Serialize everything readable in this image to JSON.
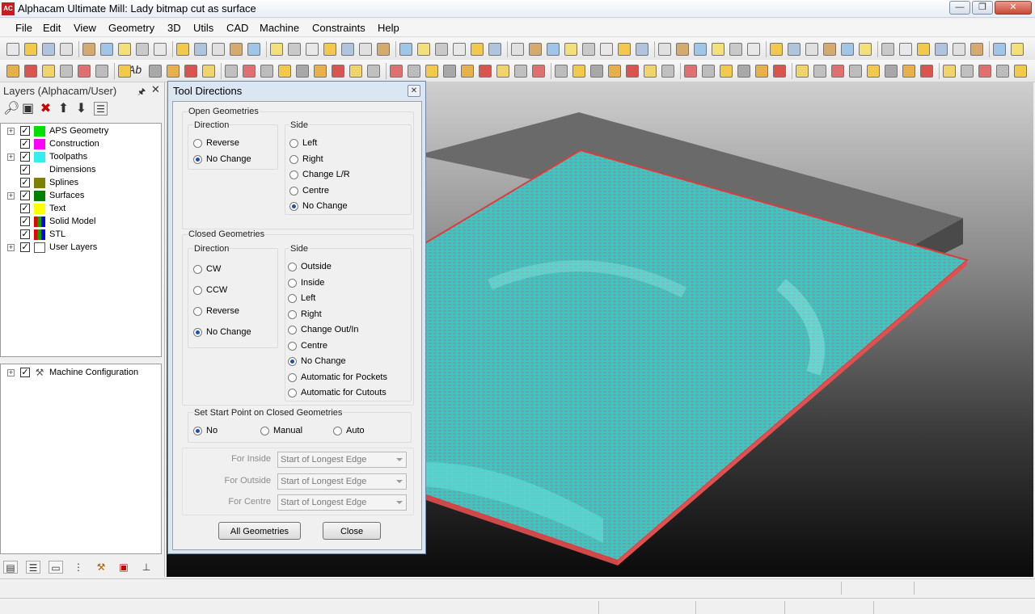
{
  "window": {
    "app_icon_text": "AC",
    "title": "Alphacam Ultimate Mill: Lady bitmap cut as surface",
    "minimize": "—",
    "maximize": "❐",
    "close": "✕"
  },
  "menu": [
    "File",
    "Edit",
    "View",
    "Geometry",
    "3D",
    "Utils",
    "CAD",
    "Machine",
    "Constraints",
    "Help"
  ],
  "toolbar2": {
    "ab_label": "Ab"
  },
  "layers_panel": {
    "title": "Layers (Alphacam/User)",
    "pin": "ᵖ",
    "close": "✕",
    "layers": [
      {
        "name": "APS Geometry",
        "color": "#00e000",
        "expandable": true
      },
      {
        "name": "Construction",
        "color": "#ff00ff",
        "expandable": false
      },
      {
        "name": "Toolpaths",
        "color": "#33eeee",
        "expandable": true
      },
      {
        "name": "Dimensions",
        "color": "#ffffff",
        "expandable": false
      },
      {
        "name": "Splines",
        "color": "#808000",
        "expandable": false
      },
      {
        "name": "Surfaces",
        "color": "#008000",
        "expandable": true
      },
      {
        "name": "Text",
        "color": "#ffff00",
        "expandable": false
      },
      {
        "name": "Solid Model",
        "color": "multi",
        "expandable": false
      },
      {
        "name": "STL",
        "color": "multi",
        "expandable": false
      },
      {
        "name": "User Layers",
        "color": "none",
        "expandable": true
      }
    ],
    "machine_item": "Machine Configuration"
  },
  "dialog": {
    "title": "Tool Directions",
    "close": "✕",
    "open_geometries": {
      "label": "Open Geometries",
      "direction_label": "Direction",
      "direction_options": [
        "Reverse",
        "No Change"
      ],
      "direction_selected": "No Change",
      "side_label": "Side",
      "side_options": [
        "Left",
        "Right",
        "Change L/R",
        "Centre",
        "No Change"
      ],
      "side_selected": "No Change"
    },
    "closed_geometries": {
      "label": "Closed Geometries",
      "direction_label": "Direction",
      "direction_options": [
        "CW",
        "CCW",
        "Reverse",
        "No Change"
      ],
      "direction_selected": "No Change",
      "side_label": "Side",
      "side_options": [
        "Outside",
        "Inside",
        "Left",
        "Right",
        "Change Out/In",
        "Centre",
        "No Change",
        "Automatic for Pockets",
        "Automatic for Cutouts"
      ],
      "side_selected": "No Change"
    },
    "start_point": {
      "label": "Set Start Point on Closed Geometries",
      "options": [
        "No",
        "Manual",
        "Auto"
      ],
      "selected": "No"
    },
    "for_inside": {
      "label": "For Inside",
      "value": "Start of Longest Edge"
    },
    "for_outside": {
      "label": "For Outside",
      "value": "Start of Longest Edge"
    },
    "for_centre": {
      "label": "For Centre",
      "value": "Start of Longest Edge"
    },
    "all_geometries_button": "All Geometries",
    "close_button": "Close"
  },
  "colors": {
    "toolpath_cyan": "#3fc6c4",
    "border_red": "#e03a3a",
    "stock_gray": "#6a6a6a"
  }
}
